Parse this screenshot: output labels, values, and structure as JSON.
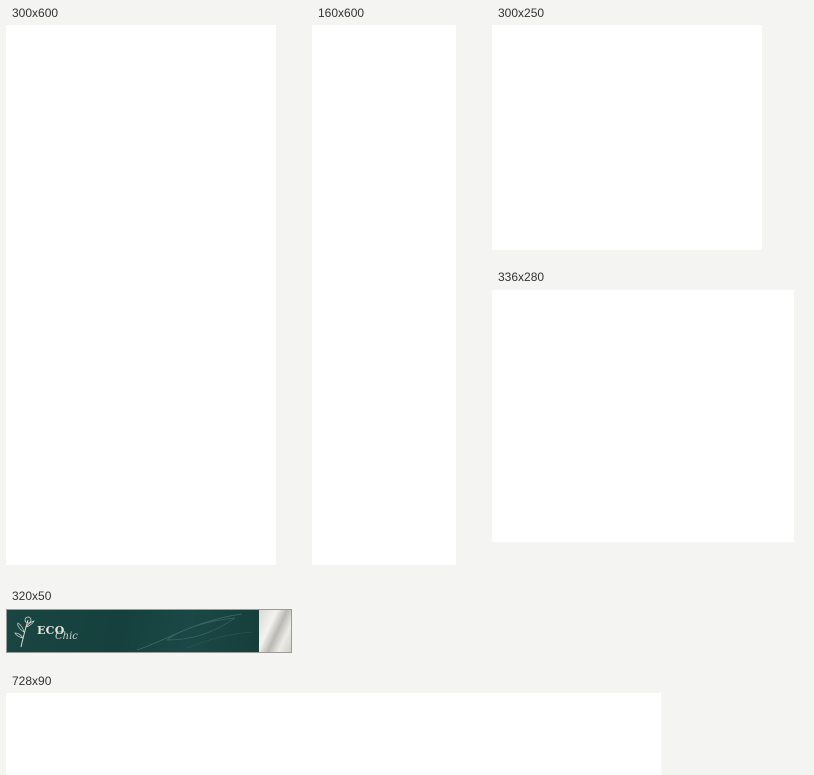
{
  "ad_slots": [
    {
      "size_label": "300x600"
    },
    {
      "size_label": "160x600"
    },
    {
      "size_label": "300x250"
    },
    {
      "size_label": "336x280"
    },
    {
      "size_label": "320x50"
    },
    {
      "size_label": "728x90"
    }
  ],
  "banner_320x50": {
    "brand_word": "ECO",
    "brand_script": "Chic",
    "logo_icon": "flower-branch-icon",
    "background_color": "#173f3d",
    "accent_color": "#e6e6e0"
  }
}
